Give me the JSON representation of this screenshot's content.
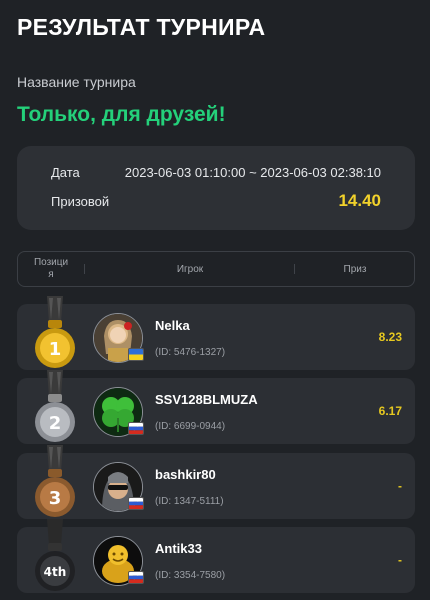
{
  "page_title": "РЕЗУЛЬТАТ ТУРНИРА",
  "tournament": {
    "label": "Название турнира",
    "name": "Только, для друзей!"
  },
  "info": {
    "date_label": "Дата",
    "date_value": "2023-06-03 01:10:00 ~ 2023-06-03 02:38:10",
    "prize_label": "Призовой",
    "prize_value": "14.40"
  },
  "table_header": {
    "position": "Позиция",
    "player": "Игрок",
    "prize": "Приз"
  },
  "rows": [
    {
      "rank": "1",
      "medal": "gold",
      "name": "Nelka",
      "id": "(ID: 5476-1327)",
      "flag": "ukraine-flag-icon",
      "prize": "8.23"
    },
    {
      "rank": "2",
      "medal": "silver",
      "name": "SSV128BLMUZA",
      "id": "(ID: 6699-0944)",
      "flag": "russia-flag-icon",
      "prize": "6.17"
    },
    {
      "rank": "3",
      "medal": "bronze",
      "name": "bashkir80",
      "id": "(ID: 1347-5111)",
      "flag": "russia-flag-icon",
      "prize": "-"
    },
    {
      "rank": "4th",
      "medal": "black",
      "name": "Antik33",
      "id": "(ID: 3354-7580)",
      "flag": "russia-flag-icon",
      "prize": "-"
    }
  ],
  "colors": {
    "background": "#1f2226",
    "accent_green": "#24d07a",
    "prize_yellow": "#f2d22b",
    "card": "#2d3035"
  }
}
